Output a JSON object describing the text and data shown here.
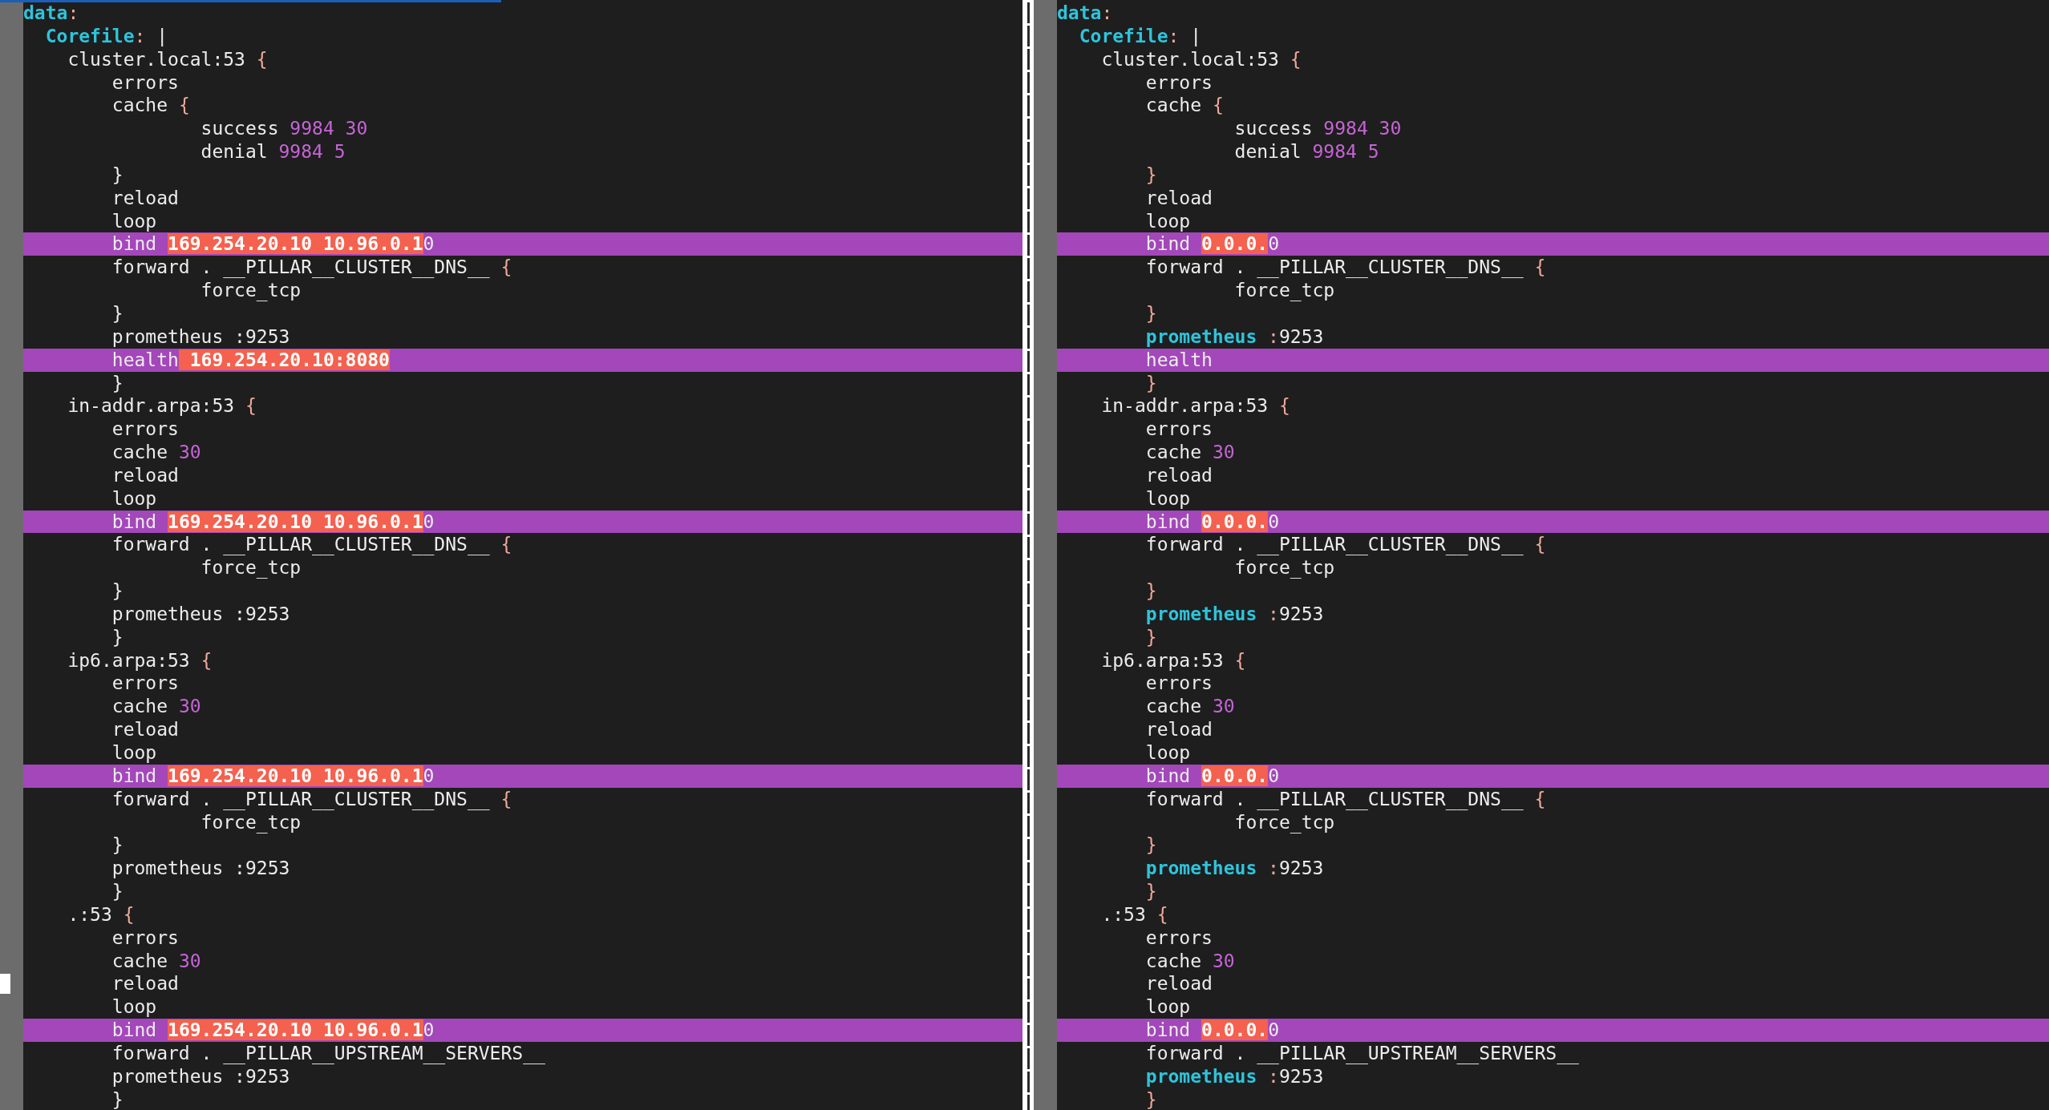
{
  "panes": [
    {
      "lines": [
        {
          "changed": false,
          "cursor": false,
          "segments": [
            {
              "text": "data",
              "kind": "key"
            },
            {
              "text": ":",
              "kind": "punct"
            }
          ]
        },
        {
          "changed": false,
          "cursor": false,
          "segments": [
            {
              "text": "  Corefile",
              "kind": "key"
            },
            {
              "text": ":",
              "kind": "punct"
            },
            {
              "text": " |",
              "kind": "plain"
            }
          ]
        },
        {
          "changed": false,
          "cursor": false,
          "segments": [
            {
              "text": "    cluster.local:53 ",
              "kind": "plain"
            },
            {
              "text": "{",
              "kind": "punct"
            }
          ]
        },
        {
          "changed": false,
          "cursor": false,
          "segments": [
            {
              "text": "        errors",
              "kind": "plain"
            }
          ]
        },
        {
          "changed": false,
          "cursor": false,
          "segments": [
            {
              "text": "        cache ",
              "kind": "plain"
            },
            {
              "text": "{",
              "kind": "punct"
            }
          ]
        },
        {
          "changed": false,
          "cursor": false,
          "segments": [
            {
              "text": "                success ",
              "kind": "plain"
            },
            {
              "text": "9984 30",
              "kind": "number"
            }
          ]
        },
        {
          "changed": false,
          "cursor": false,
          "segments": [
            {
              "text": "                denial ",
              "kind": "plain"
            },
            {
              "text": "9984 5",
              "kind": "number"
            }
          ]
        },
        {
          "changed": false,
          "cursor": false,
          "segments": [
            {
              "text": "        }",
              "kind": "plain"
            }
          ]
        },
        {
          "changed": false,
          "cursor": false,
          "segments": [
            {
              "text": "        reload",
              "kind": "plain"
            }
          ]
        },
        {
          "changed": false,
          "cursor": false,
          "segments": [
            {
              "text": "        loop",
              "kind": "plain"
            }
          ]
        },
        {
          "changed": true,
          "cursor": false,
          "segments": [
            {
              "text": "        bind ",
              "kind": "plain"
            },
            {
              "text": "169.254.20.10 10.96.0.1",
              "kind": "change"
            },
            {
              "text": "0",
              "kind": "plain"
            }
          ]
        },
        {
          "changed": false,
          "cursor": false,
          "segments": [
            {
              "text": "        forward . __PILLAR__CLUSTER__DNS__ ",
              "kind": "plain"
            },
            {
              "text": "{",
              "kind": "punct"
            }
          ]
        },
        {
          "changed": false,
          "cursor": false,
          "segments": [
            {
              "text": "                force_tcp",
              "kind": "plain"
            }
          ]
        },
        {
          "changed": false,
          "cursor": false,
          "segments": [
            {
              "text": "        }",
              "kind": "plain"
            }
          ]
        },
        {
          "changed": false,
          "cursor": false,
          "segments": [
            {
              "text": "        prometheus :9253",
              "kind": "plain"
            }
          ]
        },
        {
          "changed": true,
          "cursor": false,
          "segments": [
            {
              "text": "        health",
              "kind": "plain"
            },
            {
              "text": " 169.254.20.10:8080",
              "kind": "change"
            }
          ]
        },
        {
          "changed": false,
          "cursor": false,
          "segments": [
            {
              "text": "        }",
              "kind": "plain"
            }
          ]
        },
        {
          "changed": false,
          "cursor": false,
          "segments": [
            {
              "text": "    in-addr.arpa:53 ",
              "kind": "plain"
            },
            {
              "text": "{",
              "kind": "punct"
            }
          ]
        },
        {
          "changed": false,
          "cursor": false,
          "segments": [
            {
              "text": "        errors",
              "kind": "plain"
            }
          ]
        },
        {
          "changed": false,
          "cursor": false,
          "segments": [
            {
              "text": "        cache ",
              "kind": "plain"
            },
            {
              "text": "30",
              "kind": "number"
            }
          ]
        },
        {
          "changed": false,
          "cursor": false,
          "segments": [
            {
              "text": "        reload",
              "kind": "plain"
            }
          ]
        },
        {
          "changed": false,
          "cursor": false,
          "segments": [
            {
              "text": "        loop",
              "kind": "plain"
            }
          ]
        },
        {
          "changed": true,
          "cursor": false,
          "segments": [
            {
              "text": "        bind ",
              "kind": "plain"
            },
            {
              "text": "169.254.20.10 10.96.0.1",
              "kind": "change"
            },
            {
              "text": "0",
              "kind": "plain"
            }
          ]
        },
        {
          "changed": false,
          "cursor": false,
          "segments": [
            {
              "text": "        forward . __PILLAR__CLUSTER__DNS__ ",
              "kind": "plain"
            },
            {
              "text": "{",
              "kind": "punct"
            }
          ]
        },
        {
          "changed": false,
          "cursor": false,
          "segments": [
            {
              "text": "                force_tcp",
              "kind": "plain"
            }
          ]
        },
        {
          "changed": false,
          "cursor": false,
          "segments": [
            {
              "text": "        }",
              "kind": "plain"
            }
          ]
        },
        {
          "changed": false,
          "cursor": false,
          "segments": [
            {
              "text": "        prometheus :9253",
              "kind": "plain"
            }
          ]
        },
        {
          "changed": false,
          "cursor": false,
          "segments": [
            {
              "text": "        }",
              "kind": "plain"
            }
          ]
        },
        {
          "changed": false,
          "cursor": false,
          "segments": [
            {
              "text": "    ip6.arpa:53 ",
              "kind": "plain"
            },
            {
              "text": "{",
              "kind": "punct"
            }
          ]
        },
        {
          "changed": false,
          "cursor": false,
          "segments": [
            {
              "text": "        errors",
              "kind": "plain"
            }
          ]
        },
        {
          "changed": false,
          "cursor": false,
          "segments": [
            {
              "text": "        cache ",
              "kind": "plain"
            },
            {
              "text": "30",
              "kind": "number"
            }
          ]
        },
        {
          "changed": false,
          "cursor": false,
          "segments": [
            {
              "text": "        reload",
              "kind": "plain"
            }
          ]
        },
        {
          "changed": false,
          "cursor": false,
          "segments": [
            {
              "text": "        loop",
              "kind": "plain"
            }
          ]
        },
        {
          "changed": true,
          "cursor": false,
          "segments": [
            {
              "text": "        bind ",
              "kind": "plain"
            },
            {
              "text": "169.254.20.10 10.96.0.1",
              "kind": "change"
            },
            {
              "text": "0",
              "kind": "plain"
            }
          ]
        },
        {
          "changed": false,
          "cursor": false,
          "segments": [
            {
              "text": "        forward . __PILLAR__CLUSTER__DNS__ ",
              "kind": "plain"
            },
            {
              "text": "{",
              "kind": "punct"
            }
          ]
        },
        {
          "changed": false,
          "cursor": false,
          "segments": [
            {
              "text": "                force_tcp",
              "kind": "plain"
            }
          ]
        },
        {
          "changed": false,
          "cursor": false,
          "segments": [
            {
              "text": "        }",
              "kind": "plain"
            }
          ]
        },
        {
          "changed": false,
          "cursor": false,
          "segments": [
            {
              "text": "        prometheus :9253",
              "kind": "plain"
            }
          ]
        },
        {
          "changed": false,
          "cursor": false,
          "segments": [
            {
              "text": "        }",
              "kind": "plain"
            }
          ]
        },
        {
          "changed": false,
          "cursor": false,
          "segments": [
            {
              "text": "    .:53 ",
              "kind": "plain"
            },
            {
              "text": "{",
              "kind": "punct"
            }
          ]
        },
        {
          "changed": false,
          "cursor": false,
          "segments": [
            {
              "text": "        errors",
              "kind": "plain"
            }
          ]
        },
        {
          "changed": false,
          "cursor": false,
          "segments": [
            {
              "text": "        cache ",
              "kind": "plain"
            },
            {
              "text": "30",
              "kind": "number"
            }
          ]
        },
        {
          "changed": false,
          "cursor": true,
          "segments": [
            {
              "text": "        reload",
              "kind": "plain"
            }
          ]
        },
        {
          "changed": false,
          "cursor": false,
          "segments": [
            {
              "text": "        loop",
              "kind": "plain"
            }
          ]
        },
        {
          "changed": true,
          "cursor": false,
          "segments": [
            {
              "text": "        bind ",
              "kind": "plain"
            },
            {
              "text": "169.254.20.10 10.96.0.1",
              "kind": "change"
            },
            {
              "text": "0",
              "kind": "plain"
            }
          ]
        },
        {
          "changed": false,
          "cursor": false,
          "segments": [
            {
              "text": "        forward . __PILLAR__UPSTREAM__SERVERS__",
              "kind": "plain"
            }
          ]
        },
        {
          "changed": false,
          "cursor": false,
          "segments": [
            {
              "text": "        prometheus :9253",
              "kind": "plain"
            }
          ]
        },
        {
          "changed": false,
          "cursor": false,
          "segments": [
            {
              "text": "        }",
              "kind": "plain"
            }
          ]
        }
      ]
    },
    {
      "lines": [
        {
          "changed": false,
          "cursor": false,
          "segments": [
            {
              "text": "data",
              "kind": "key"
            },
            {
              "text": ":",
              "kind": "punct"
            }
          ]
        },
        {
          "changed": false,
          "cursor": false,
          "segments": [
            {
              "text": "  Corefile",
              "kind": "key"
            },
            {
              "text": ":",
              "kind": "punct"
            },
            {
              "text": " |",
              "kind": "plain"
            }
          ]
        },
        {
          "changed": false,
          "cursor": false,
          "segments": [
            {
              "text": "    cluster.local:53 ",
              "kind": "plain"
            },
            {
              "text": "{",
              "kind": "punct"
            }
          ]
        },
        {
          "changed": false,
          "cursor": false,
          "segments": [
            {
              "text": "        errors",
              "kind": "plain"
            }
          ]
        },
        {
          "changed": false,
          "cursor": false,
          "segments": [
            {
              "text": "        cache ",
              "kind": "plain"
            },
            {
              "text": "{",
              "kind": "punct"
            }
          ]
        },
        {
          "changed": false,
          "cursor": false,
          "segments": [
            {
              "text": "                success ",
              "kind": "plain"
            },
            {
              "text": "9984 30",
              "kind": "number"
            }
          ]
        },
        {
          "changed": false,
          "cursor": false,
          "segments": [
            {
              "text": "                denial ",
              "kind": "plain"
            },
            {
              "text": "9984 5",
              "kind": "number"
            }
          ]
        },
        {
          "changed": false,
          "cursor": false,
          "segments": [
            {
              "text": "        }",
              "kind": "punct"
            }
          ]
        },
        {
          "changed": false,
          "cursor": false,
          "segments": [
            {
              "text": "        reload",
              "kind": "plain"
            }
          ]
        },
        {
          "changed": false,
          "cursor": false,
          "segments": [
            {
              "text": "        loop",
              "kind": "plain"
            }
          ]
        },
        {
          "changed": true,
          "cursor": false,
          "segments": [
            {
              "text": "        bind ",
              "kind": "plain"
            },
            {
              "text": "0.0.0.",
              "kind": "change"
            },
            {
              "text": "0",
              "kind": "plain"
            }
          ]
        },
        {
          "changed": false,
          "cursor": false,
          "segments": [
            {
              "text": "        forward . __PILLAR__CLUSTER__DNS__ ",
              "kind": "plain"
            },
            {
              "text": "{",
              "kind": "punct"
            }
          ]
        },
        {
          "changed": false,
          "cursor": false,
          "segments": [
            {
              "text": "                force_tcp",
              "kind": "plain"
            }
          ]
        },
        {
          "changed": false,
          "cursor": false,
          "segments": [
            {
              "text": "        }",
              "kind": "punct"
            }
          ]
        },
        {
          "changed": false,
          "cursor": false,
          "segments": [
            {
              "text": "        prometheus",
              "kind": "key"
            },
            {
              "text": " :",
              "kind": "punct"
            },
            {
              "text": "9253",
              "kind": "plain"
            }
          ]
        },
        {
          "changed": true,
          "cursor": false,
          "segments": [
            {
              "text": "        health",
              "kind": "plain"
            }
          ]
        },
        {
          "changed": false,
          "cursor": false,
          "segments": [
            {
              "text": "        }",
              "kind": "punct"
            }
          ]
        },
        {
          "changed": false,
          "cursor": false,
          "segments": [
            {
              "text": "    in-addr.arpa:53 ",
              "kind": "plain"
            },
            {
              "text": "{",
              "kind": "punct"
            }
          ]
        },
        {
          "changed": false,
          "cursor": false,
          "segments": [
            {
              "text": "        errors",
              "kind": "plain"
            }
          ]
        },
        {
          "changed": false,
          "cursor": false,
          "segments": [
            {
              "text": "        cache ",
              "kind": "plain"
            },
            {
              "text": "30",
              "kind": "number"
            }
          ]
        },
        {
          "changed": false,
          "cursor": false,
          "segments": [
            {
              "text": "        reload",
              "kind": "plain"
            }
          ]
        },
        {
          "changed": false,
          "cursor": false,
          "segments": [
            {
              "text": "        loop",
              "kind": "plain"
            }
          ]
        },
        {
          "changed": true,
          "cursor": false,
          "segments": [
            {
              "text": "        bind ",
              "kind": "plain"
            },
            {
              "text": "0.0.0.",
              "kind": "change"
            },
            {
              "text": "0",
              "kind": "plain"
            }
          ]
        },
        {
          "changed": false,
          "cursor": false,
          "segments": [
            {
              "text": "        forward . __PILLAR__CLUSTER__DNS__ ",
              "kind": "plain"
            },
            {
              "text": "{",
              "kind": "punct"
            }
          ]
        },
        {
          "changed": false,
          "cursor": false,
          "segments": [
            {
              "text": "                force_tcp",
              "kind": "plain"
            }
          ]
        },
        {
          "changed": false,
          "cursor": false,
          "segments": [
            {
              "text": "        }",
              "kind": "punct"
            }
          ]
        },
        {
          "changed": false,
          "cursor": false,
          "segments": [
            {
              "text": "        prometheus",
              "kind": "key"
            },
            {
              "text": " :",
              "kind": "punct"
            },
            {
              "text": "9253",
              "kind": "plain"
            }
          ]
        },
        {
          "changed": false,
          "cursor": false,
          "segments": [
            {
              "text": "        }",
              "kind": "punct"
            }
          ]
        },
        {
          "changed": false,
          "cursor": false,
          "segments": [
            {
              "text": "    ip6.arpa:53 ",
              "kind": "plain"
            },
            {
              "text": "{",
              "kind": "punct"
            }
          ]
        },
        {
          "changed": false,
          "cursor": false,
          "segments": [
            {
              "text": "        errors",
              "kind": "plain"
            }
          ]
        },
        {
          "changed": false,
          "cursor": false,
          "segments": [
            {
              "text": "        cache ",
              "kind": "plain"
            },
            {
              "text": "30",
              "kind": "number"
            }
          ]
        },
        {
          "changed": false,
          "cursor": false,
          "segments": [
            {
              "text": "        reload",
              "kind": "plain"
            }
          ]
        },
        {
          "changed": false,
          "cursor": false,
          "segments": [
            {
              "text": "        loop",
              "kind": "plain"
            }
          ]
        },
        {
          "changed": true,
          "cursor": false,
          "segments": [
            {
              "text": "        bind ",
              "kind": "plain"
            },
            {
              "text": "0.0.0.",
              "kind": "change"
            },
            {
              "text": "0",
              "kind": "plain"
            }
          ]
        },
        {
          "changed": false,
          "cursor": false,
          "segments": [
            {
              "text": "        forward . __PILLAR__CLUSTER__DNS__ ",
              "kind": "plain"
            },
            {
              "text": "{",
              "kind": "punct"
            }
          ]
        },
        {
          "changed": false,
          "cursor": false,
          "segments": [
            {
              "text": "                force_tcp",
              "kind": "plain"
            }
          ]
        },
        {
          "changed": false,
          "cursor": false,
          "segments": [
            {
              "text": "        }",
              "kind": "punct"
            }
          ]
        },
        {
          "changed": false,
          "cursor": false,
          "segments": [
            {
              "text": "        prometheus",
              "kind": "key"
            },
            {
              "text": " :",
              "kind": "punct"
            },
            {
              "text": "9253",
              "kind": "plain"
            }
          ]
        },
        {
          "changed": false,
          "cursor": false,
          "segments": [
            {
              "text": "        }",
              "kind": "punct"
            }
          ]
        },
        {
          "changed": false,
          "cursor": false,
          "segments": [
            {
              "text": "    .:53 ",
              "kind": "plain"
            },
            {
              "text": "{",
              "kind": "punct"
            }
          ]
        },
        {
          "changed": false,
          "cursor": false,
          "segments": [
            {
              "text": "        errors",
              "kind": "plain"
            }
          ]
        },
        {
          "changed": false,
          "cursor": false,
          "segments": [
            {
              "text": "        cache ",
              "kind": "plain"
            },
            {
              "text": "30",
              "kind": "number"
            }
          ]
        },
        {
          "changed": false,
          "cursor": false,
          "segments": [
            {
              "text": "        reload",
              "kind": "plain"
            }
          ]
        },
        {
          "changed": false,
          "cursor": false,
          "segments": [
            {
              "text": "        loop",
              "kind": "plain"
            }
          ]
        },
        {
          "changed": true,
          "cursor": false,
          "segments": [
            {
              "text": "        bind ",
              "kind": "plain"
            },
            {
              "text": "0.0.0.",
              "kind": "change"
            },
            {
              "text": "0",
              "kind": "plain"
            }
          ]
        },
        {
          "changed": false,
          "cursor": false,
          "segments": [
            {
              "text": "        forward . __PILLAR__UPSTREAM__SERVERS__",
              "kind": "plain"
            }
          ]
        },
        {
          "changed": false,
          "cursor": false,
          "segments": [
            {
              "text": "        prometheus",
              "kind": "key"
            },
            {
              "text": " :",
              "kind": "punct"
            },
            {
              "text": "9253",
              "kind": "plain"
            }
          ]
        },
        {
          "changed": false,
          "cursor": false,
          "segments": [
            {
              "text": "        }",
              "kind": "punct"
            }
          ]
        }
      ]
    }
  ]
}
